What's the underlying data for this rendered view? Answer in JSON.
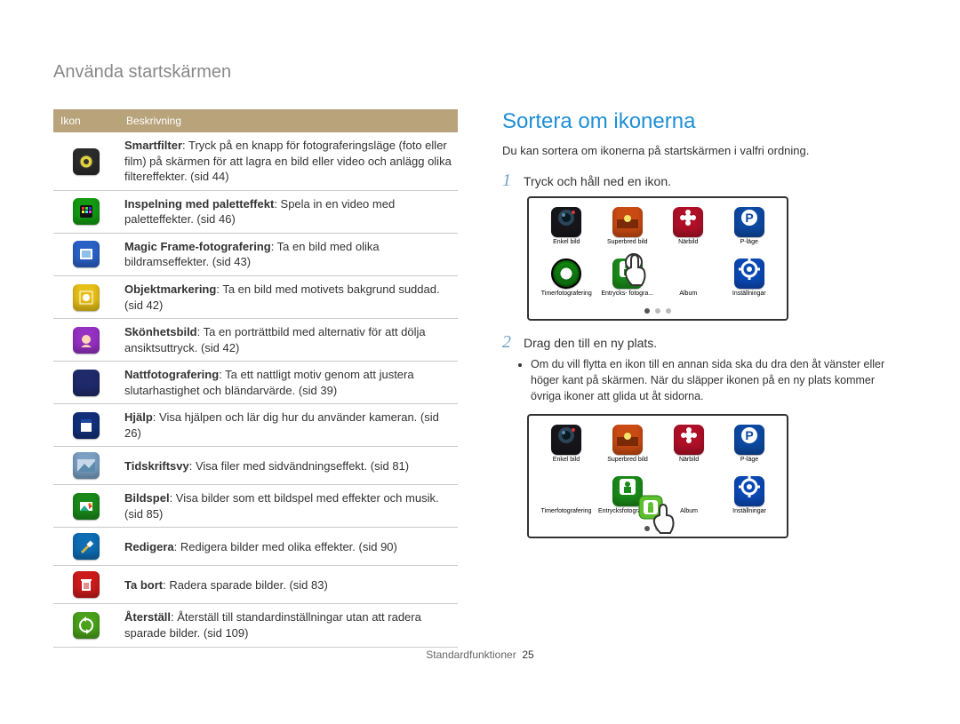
{
  "header": "Använda startskärmen",
  "table": {
    "col_icon": "Ikon",
    "col_desc": "Beskrivning",
    "rows": [
      {
        "color": "#2b2b2b",
        "glyph": "camera-dot",
        "bold": "Smartfilter",
        "rest": ": Tryck på en knapp för fotograferingsläge (foto eller film) på skärmen för att lagra en bild eller video och anlägg olika filtereffekter. (sid 44)"
      },
      {
        "color": "#129b12",
        "glyph": "grid",
        "bold": "Inspelning med paletteffekt",
        "rest": ": Spela in en video med paletteffekter. (sid 46)"
      },
      {
        "color": "#2a61c7",
        "glyph": "frame",
        "bold": "Magic Frame-fotografering",
        "rest": ": Ta en bild med olika bildramseffekter. (sid 43)"
      },
      {
        "color": "#e7c018",
        "glyph": "focus",
        "bold": "Objektmarkering",
        "rest": ": Ta en bild med motivets bakgrund suddad. (sid 42)"
      },
      {
        "color": "#9531c3",
        "glyph": "face",
        "bold": "Skönhetsbild",
        "rest": ": Ta en porträttbild med alternativ för att dölja ansiktsuttryck. (sid 42)"
      },
      {
        "color": "#1f2a6b",
        "glyph": "moon",
        "bold": "Nattfotografering",
        "rest": ": Ta ett nattligt motiv genom att justera slutarhastighet och bländarvärde. (sid 39)"
      },
      {
        "color": "#12307a",
        "glyph": "book",
        "bold": "Hjälp",
        "rest": ": Visa hjälpen och lär dig hur du använder kameran. (sid 26)"
      },
      {
        "color": "#7aa0c4",
        "glyph": "mag",
        "bold": "Tidskriftsvy",
        "rest": ": Visa filer med sidvändningseffekt. (sid 81)"
      },
      {
        "color": "#1a8a1a",
        "glyph": "slides",
        "bold": "Bildspel",
        "rest": ": Visa bilder som ett bildspel med effekter och musik. (sid 85)"
      },
      {
        "color": "#0e6db3",
        "glyph": "brush",
        "bold": "Redigera",
        "rest": ": Redigera bilder med olika effekter. (sid 90)"
      },
      {
        "color": "#cc1b1b",
        "glyph": "trash",
        "bold": "Ta bort",
        "rest": ": Radera sparade bilder. (sid 83)"
      },
      {
        "color": "#4aa11a",
        "glyph": "refresh",
        "bold": "Återställ",
        "rest": ": Återställ till standardinställningar utan att radera sparade bilder. (sid 109)"
      }
    ]
  },
  "section_title": "Sortera om ikonerna",
  "intro": "Du kan sortera om ikonerna på startskärmen i valfri ordning.",
  "step1": "Tryck och håll ned en ikon.",
  "step2": "Drag den till en ny plats.",
  "bullet1": "Om du vill flytta en ikon till en annan sida ska du dra den åt vänster eller höger kant på skärmen. När du släpper ikonen på en ny plats kommer övriga ikoner att glida ut åt sidorna.",
  "panel_items": [
    {
      "color": "#17161b",
      "glyph": "lens",
      "label": "Enkel bild"
    },
    {
      "color": "#c94a12",
      "glyph": "sunset",
      "label": "Superbred bild"
    },
    {
      "color": "#b01028",
      "glyph": "flower",
      "label": "Närbild"
    },
    {
      "color": "#0d4aa3",
      "glyph": "p",
      "label": "P-läge"
    },
    {
      "color": "ring",
      "glyph": "ring",
      "label": "Timerfotografering"
    },
    {
      "color": "#1a8a1a",
      "glyph": "person",
      "label": "Entrycksfotografering",
      "short": "Entrycks-\nfotogra..."
    },
    {
      "color": "",
      "glyph": "blank",
      "label": "Album"
    },
    {
      "color": "#0b49b5",
      "glyph": "gear",
      "label": "Inställningar"
    }
  ],
  "footer_section": "Standardfunktioner",
  "footer_page": "25"
}
